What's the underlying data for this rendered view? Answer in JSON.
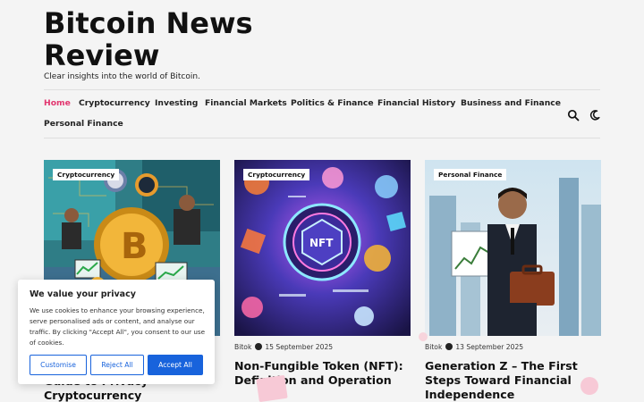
{
  "site": {
    "title": "Bitcoin News Review",
    "tagline": "Clear insights into the world of Bitcoin."
  },
  "nav": {
    "items": [
      {
        "label": "Home",
        "active": true
      },
      {
        "label": "Cryptocurrency",
        "active": false
      },
      {
        "label": "Investing",
        "active": false
      },
      {
        "label": "Financial Markets",
        "active": false
      },
      {
        "label": "Politics & Finance",
        "active": false
      },
      {
        "label": "Financial History",
        "active": false
      },
      {
        "label": "Business and Finance",
        "active": false
      },
      {
        "label": "Personal Finance",
        "active": false
      }
    ],
    "icons": [
      "search-icon",
      "moon-icon"
    ]
  },
  "posts": [
    {
      "category": "Cryptocurrency",
      "title": "Guide to Privacy Cryptocurrency",
      "author": "",
      "date": ""
    },
    {
      "category": "Cryptocurrency",
      "title": "Non-Fungible Token (NFT): Definition and Operation",
      "author": "Bitok",
      "date": "15 September 2025"
    },
    {
      "category": "Personal Finance",
      "title": "Generation Z – The First Steps Toward Financial Independence",
      "author": "Bitok",
      "date": "13 September 2025"
    }
  ],
  "cookie_banner": {
    "title": "We value your privacy",
    "text": "We use cookies to enhance your browsing experience, serve personalised ads or content, and analyse our traffic. By clicking \"Accept All\", you consent to our use of cookies.",
    "customise_label": "Customise",
    "reject_label": "Reject All",
    "accept_label": "Accept All"
  },
  "colors": {
    "accent": "#e2366f",
    "button_blue": "#1863dc",
    "background": "#f4f4f4"
  }
}
